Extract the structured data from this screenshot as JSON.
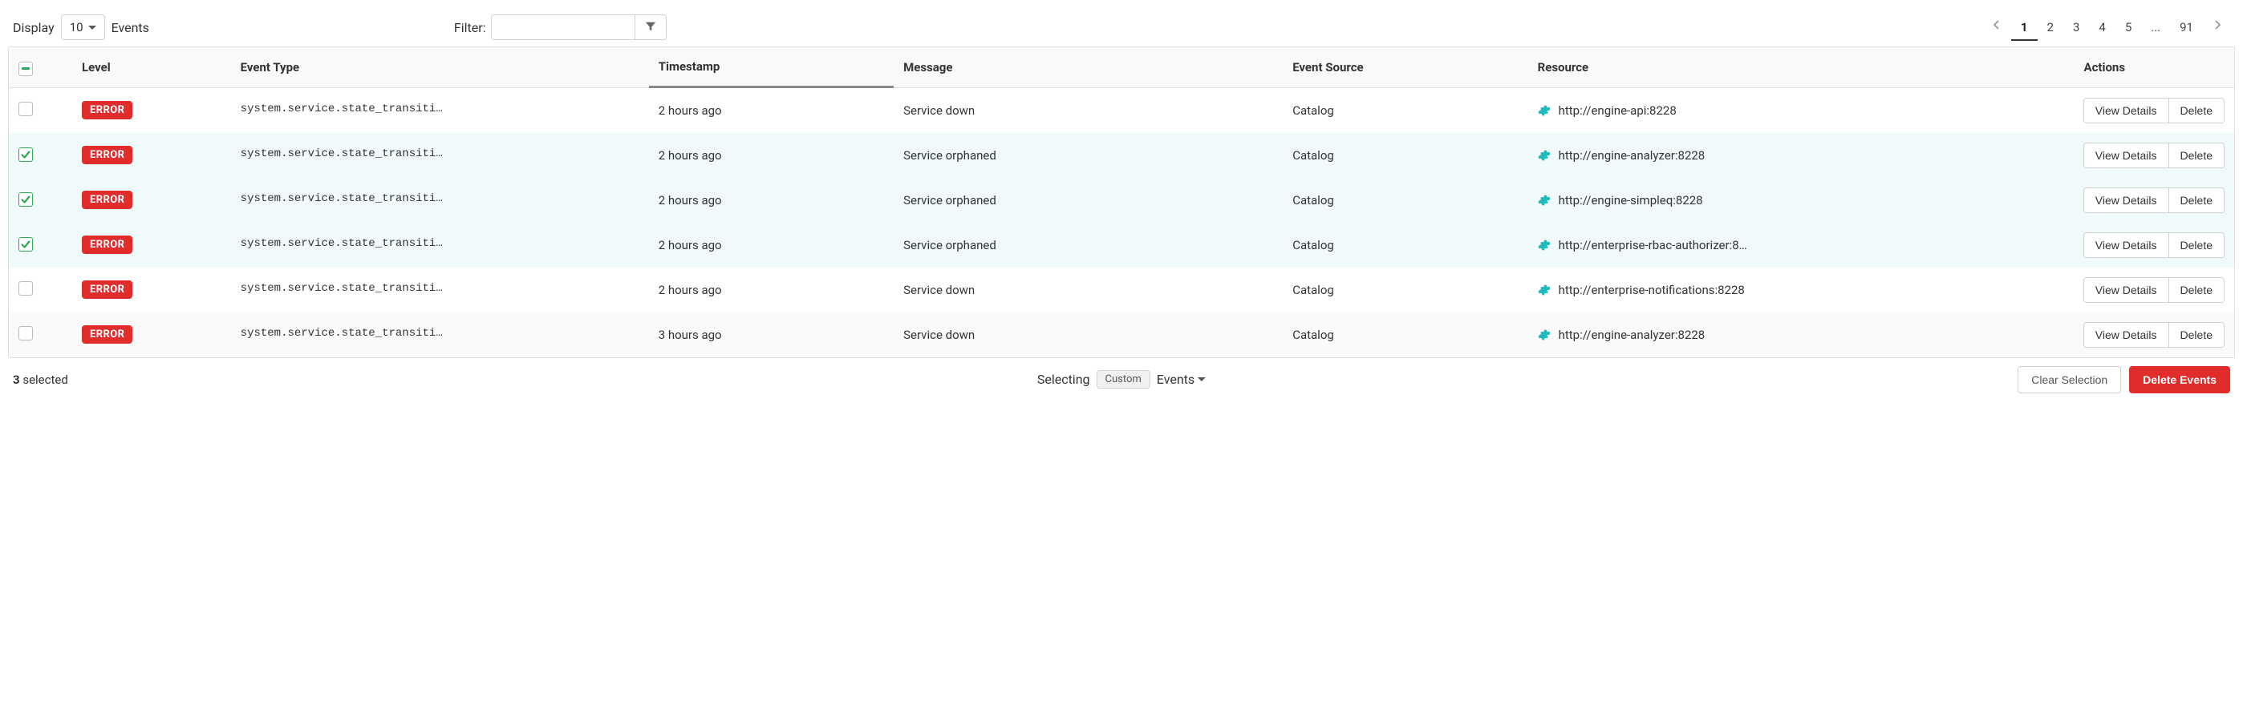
{
  "toolbar": {
    "display_label": "Display",
    "page_size": "10",
    "events_label": "Events",
    "filter_label": "Filter:",
    "filter_value": ""
  },
  "pagination": {
    "pages": [
      "1",
      "2",
      "3",
      "4",
      "5",
      "...",
      "91"
    ],
    "active": "1"
  },
  "columns": {
    "level": "Level",
    "event_type": "Event Type",
    "timestamp": "Timestamp",
    "message": "Message",
    "source": "Event Source",
    "resource": "Resource",
    "actions": "Actions"
  },
  "rows": [
    {
      "checked": false,
      "alt": false,
      "level": "ERROR",
      "event_type": "system.service.state_transition.d…",
      "timestamp": "2 hours ago",
      "message": "Service down",
      "source": "Catalog",
      "resource": "http://engine-api:8228"
    },
    {
      "checked": true,
      "alt": false,
      "level": "ERROR",
      "event_type": "system.service.state_transition.o…",
      "timestamp": "2 hours ago",
      "message": "Service orphaned",
      "source": "Catalog",
      "resource": "http://engine-analyzer:8228"
    },
    {
      "checked": true,
      "alt": false,
      "level": "ERROR",
      "event_type": "system.service.state_transition.o…",
      "timestamp": "2 hours ago",
      "message": "Service orphaned",
      "source": "Catalog",
      "resource": "http://engine-simpleq:8228"
    },
    {
      "checked": true,
      "alt": false,
      "level": "ERROR",
      "event_type": "system.service.state_transition.o…",
      "timestamp": "2 hours ago",
      "message": "Service orphaned",
      "source": "Catalog",
      "resource": "http://enterprise-rbac-authorizer:8…"
    },
    {
      "checked": false,
      "alt": false,
      "level": "ERROR",
      "event_type": "system.service.state_transition.d…",
      "timestamp": "2 hours ago",
      "message": "Service down",
      "source": "Catalog",
      "resource": "http://enterprise-notifications:8228"
    },
    {
      "checked": false,
      "alt": true,
      "level": "ERROR",
      "event_type": "system.service.state_transition.d…",
      "timestamp": "3 hours ago",
      "message": "Service down",
      "source": "Catalog",
      "resource": "http://engine-analyzer:8228"
    }
  ],
  "actions": {
    "view_details": "View Details",
    "delete": "Delete"
  },
  "footer": {
    "selected_count": "3",
    "selected_suffix": " selected",
    "selecting_label": "Selecting",
    "custom_pill": "Custom",
    "events_dropdown": "Events",
    "clear_selection": "Clear Selection",
    "delete_events": "Delete Events"
  },
  "colors": {
    "error_badge": "#e12c2c",
    "gear_icon": "#1fbaba",
    "check_green": "#2aaa54"
  }
}
